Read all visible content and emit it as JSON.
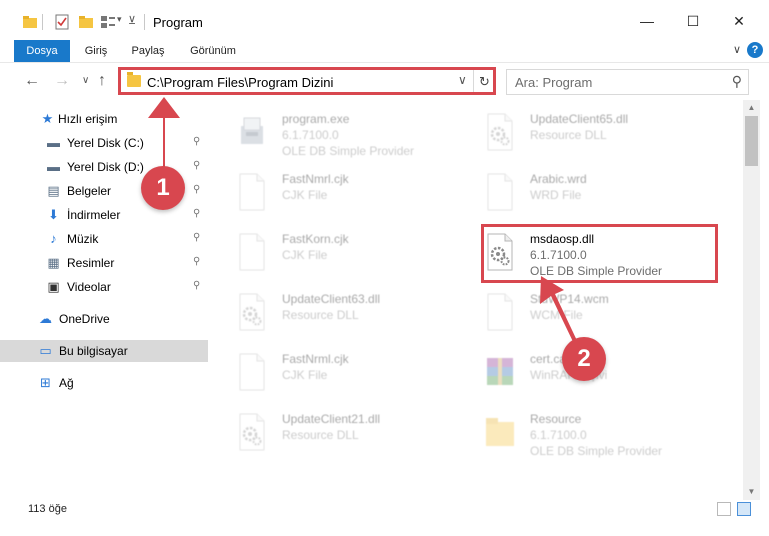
{
  "window": {
    "title": "Program",
    "minimize_glyph": "—",
    "maximize_glyph": "☐",
    "close_glyph": "✕"
  },
  "ribbon": {
    "tabs": [
      {
        "label": "Dosya",
        "active": true
      },
      {
        "label": "Giriş",
        "active": false
      },
      {
        "label": "Paylaş",
        "active": false
      },
      {
        "label": "Görünüm",
        "active": false
      }
    ],
    "expand_glyph": "∨",
    "help_glyph": "?"
  },
  "nav": {
    "back_glyph": "←",
    "forward_glyph": "→",
    "recent_glyph": "∨",
    "up_glyph": "↑",
    "address": "C:\\Program Files\\Program Dizini",
    "dropdown_glyph": "∨",
    "refresh_glyph": "↻",
    "search_placeholder": "Ara: Program",
    "search_glyph": "⚲"
  },
  "sidebar": {
    "items": [
      {
        "label": "Hızlı erişim",
        "icon": "star-icon",
        "glyph": "★",
        "color": "#2d7ad6",
        "pinned": false
      },
      {
        "label": "Yerel Disk (C:)",
        "icon": "drive-icon",
        "glyph": "▬",
        "color": "#5a6f86",
        "pinned": true
      },
      {
        "label": "Yerel Disk (D:)",
        "icon": "drive-icon",
        "glyph": "▬",
        "color": "#5a6f86",
        "pinned": true
      },
      {
        "label": "Belgeler",
        "icon": "documents-icon",
        "glyph": "▤",
        "color": "#5a6f86",
        "pinned": true
      },
      {
        "label": "İndirmeler",
        "icon": "download-icon",
        "glyph": "⬇",
        "color": "#2d7ad6",
        "pinned": true
      },
      {
        "label": "Müzik",
        "icon": "music-icon",
        "glyph": "♪",
        "color": "#2d7ad6",
        "pinned": true
      },
      {
        "label": "Resimler",
        "icon": "pictures-icon",
        "glyph": "▦",
        "color": "#5a6f86",
        "pinned": true
      },
      {
        "label": "Videolar",
        "icon": "videos-icon",
        "glyph": "▣",
        "color": "#333333",
        "pinned": true
      },
      {
        "label": "OneDrive",
        "icon": "cloud-icon",
        "glyph": "☁",
        "color": "#2d7ad6",
        "pinned": false
      },
      {
        "label": "Bu bilgisayar",
        "icon": "computer-icon",
        "glyph": "▭",
        "color": "#2d7ad6",
        "pinned": false
      },
      {
        "label": "Ağ",
        "icon": "network-icon",
        "glyph": "⊞",
        "color": "#2d7ad6",
        "pinned": false
      }
    ],
    "pin_glyph": "📌"
  },
  "files": [
    {
      "name": "program.exe",
      "line2": "6.1.7100.0",
      "line3": "OLE DB Simple Provider",
      "icon": "installer-icon",
      "faded": true,
      "highlighted": false
    },
    {
      "name": "UpdateClient65.dll",
      "line2": "Resource DLL",
      "line3": "",
      "icon": "dll-icon",
      "faded": true,
      "highlighted": false
    },
    {
      "name": "FastNmrl.cjk",
      "line2": "CJK File",
      "line3": "",
      "icon": "file-icon",
      "faded": true,
      "highlighted": false
    },
    {
      "name": "Arabic.wrd",
      "line2": "WRD File",
      "line3": "",
      "icon": "file-icon",
      "faded": true,
      "highlighted": false
    },
    {
      "name": "FastKorn.cjk",
      "line2": "CJK File",
      "line3": "",
      "icon": "file-icon",
      "faded": true,
      "highlighted": false
    },
    {
      "name": "msdaosp.dll",
      "line2": "6.1.7100.0",
      "line3": "OLE DB Simple Provider",
      "icon": "dll-icon",
      "faded": false,
      "highlighted": true
    },
    {
      "name": "UpdateClient63.dll",
      "line2": "Resource DLL",
      "line3": "",
      "icon": "dll-icon",
      "faded": true,
      "highlighted": false
    },
    {
      "name": "StdWP14.wcm",
      "line2": "WCM File",
      "line3": "",
      "icon": "file-icon",
      "faded": true,
      "highlighted": false
    },
    {
      "name": "FastNrml.cjk",
      "line2": "CJK File",
      "line3": "",
      "icon": "file-icon",
      "faded": true,
      "highlighted": false
    },
    {
      "name": "cert.cab",
      "line2": "WinRAR arşivi",
      "line3": "",
      "icon": "archive-icon",
      "faded": true,
      "highlighted": false
    },
    {
      "name": "UpdateClient21.dll",
      "line2": "Resource DLL",
      "line3": "",
      "icon": "dll-icon",
      "faded": true,
      "highlighted": false
    },
    {
      "name": "Resource",
      "line2": "6.1.7100.0",
      "line3": "OLE DB Simple Provider",
      "icon": "folder-icon",
      "faded": true,
      "highlighted": false
    }
  ],
  "status": {
    "item_count": "113 öğe"
  },
  "annotations": {
    "accent": "#d8474f",
    "badges": [
      "1",
      "2"
    ]
  },
  "colors": {
    "accent_blue": "#1979ca",
    "selection_gray": "#d9d9d9"
  }
}
